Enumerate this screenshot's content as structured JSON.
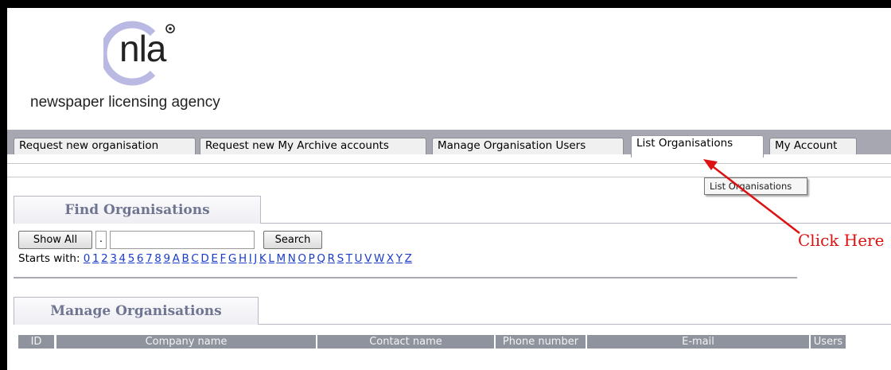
{
  "logo": {
    "text": "nla",
    "tagline": "newspaper licensing agency"
  },
  "tabs": [
    {
      "label": "Request new organisation",
      "active": false
    },
    {
      "label": "Request new My Archive accounts",
      "active": false
    },
    {
      "label": "Manage Organisation Users",
      "active": false
    },
    {
      "label": "List Organisations",
      "active": true
    },
    {
      "label": "My Account",
      "active": false
    }
  ],
  "tooltip": "List Organisations",
  "find_section": {
    "title": "Find Organisations",
    "show_all_label": "Show All",
    "separator": ".",
    "search_value": "",
    "search_label": "Search",
    "starts_with_label": "Starts with:",
    "letters": [
      "0",
      "1",
      "2",
      "3",
      "4",
      "5",
      "6",
      "7",
      "8",
      "9",
      "A",
      "B",
      "C",
      "D",
      "E",
      "F",
      "G",
      "H",
      "I",
      "J",
      "K",
      "L",
      "M",
      "N",
      "O",
      "P",
      "Q",
      "R",
      "S",
      "T",
      "U",
      "V",
      "W",
      "X",
      "Y",
      "Z"
    ]
  },
  "manage_section": {
    "title": "Manage Organisations",
    "columns": [
      "ID",
      "Company name",
      "Contact name",
      "Phone number",
      "E-mail",
      "Users"
    ]
  },
  "annotation": {
    "text": "Click Here",
    "color": "#dd1111"
  },
  "colors": {
    "tab_bar": "#a7a7b1",
    "link": "#1a3cc8",
    "table_header": "#8f939d",
    "section_title": "#6f7591"
  }
}
